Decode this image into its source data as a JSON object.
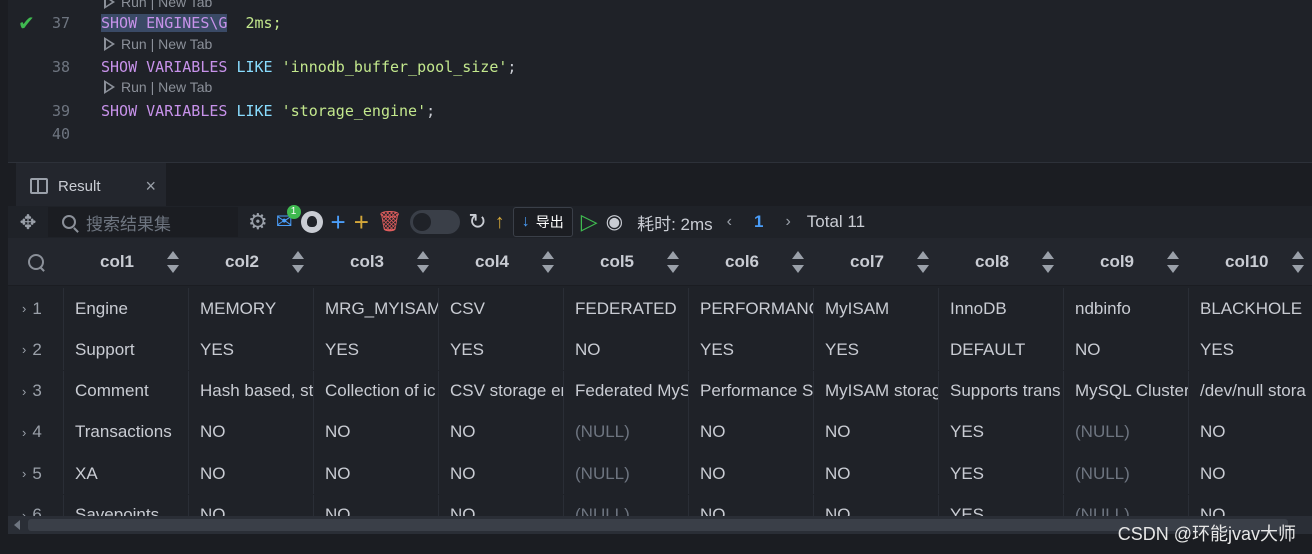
{
  "editor": {
    "codelens": "Run | New Tab",
    "lines": [
      {
        "num": "37",
        "sql_kw": "SHOW ENGINES\\G",
        "rest": "  2ms;"
      },
      {
        "num": "38",
        "kw1": "SHOW VARIABLES",
        "kw2": " LIKE ",
        "str": "'innodb_buffer_pool_size'",
        "end": ";"
      },
      {
        "num": "39",
        "kw1": "SHOW VARIABLES",
        "kw2": " LIKE ",
        "str": "'storage_engine'",
        "end": ";"
      },
      {
        "num": "40"
      }
    ]
  },
  "panel": {
    "tab_label": "Result",
    "close": "×"
  },
  "toolbar": {
    "search_placeholder": "搜索结果集",
    "mail_badge": "1",
    "export_label": "导出",
    "time_label": "耗时: 2ms",
    "page_current": "1",
    "total_label": "Total 11"
  },
  "grid": {
    "headers": [
      "col1",
      "col2",
      "col3",
      "col4",
      "col5",
      "col6",
      "col7",
      "col8",
      "col9",
      "col10"
    ],
    "rows": [
      {
        "n": "1",
        "cells": [
          "Engine",
          "MEMORY",
          "MRG_MYISAM",
          "CSV",
          "FEDERATED",
          "PERFORMANC",
          "MyISAM",
          "InnoDB",
          "ndbinfo",
          "BLACKHOLE"
        ]
      },
      {
        "n": "2",
        "cells": [
          "Support",
          "YES",
          "YES",
          "YES",
          "NO",
          "YES",
          "YES",
          "DEFAULT",
          "NO",
          "YES"
        ]
      },
      {
        "n": "3",
        "cells": [
          "Comment",
          "Hash based, st",
          "Collection of ic",
          "CSV storage er",
          "Federated MyS",
          "Performance S",
          "MyISAM storag",
          "Supports trans",
          "MySQL Cluster",
          "/dev/null stora"
        ]
      },
      {
        "n": "4",
        "cells": [
          "Transactions",
          "NO",
          "NO",
          "NO",
          "(NULL)",
          "NO",
          "NO",
          "YES",
          "(NULL)",
          "NO"
        ]
      },
      {
        "n": "5",
        "cells": [
          "XA",
          "NO",
          "NO",
          "NO",
          "(NULL)",
          "NO",
          "NO",
          "YES",
          "(NULL)",
          "NO"
        ]
      },
      {
        "n": "6",
        "cells": [
          "Savepoints",
          "NO",
          "NO",
          "NO",
          "(NULL)",
          "NO",
          "NO",
          "YES",
          "(NULL)",
          "NO"
        ]
      }
    ]
  },
  "watermark": "CSDN @环能jvav大师"
}
